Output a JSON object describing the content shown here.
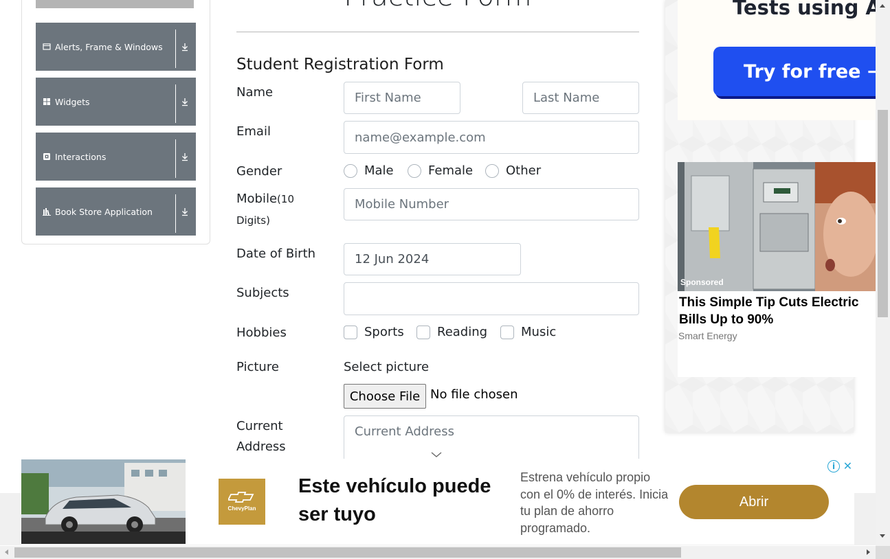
{
  "sidebar": {
    "groups": [
      {
        "label": "Alerts, Frame & Windows",
        "icon": "window-icon"
      },
      {
        "label": "Widgets",
        "icon": "grid-icon"
      },
      {
        "label": "Interactions",
        "icon": "interactions-icon"
      },
      {
        "label": "Book Store Application",
        "icon": "books-icon"
      }
    ]
  },
  "page": {
    "title": "Practice Form"
  },
  "form": {
    "heading": "Student Registration Form",
    "name_label": "Name",
    "first_name_placeholder": "First Name",
    "last_name_placeholder": "Last Name",
    "email_label": "Email",
    "email_placeholder": "name@example.com",
    "gender_label": "Gender",
    "gender_options": [
      "Male",
      "Female",
      "Other"
    ],
    "mobile_label": "Mobile",
    "mobile_hint_a": "(10",
    "mobile_hint_b": "Digits)",
    "mobile_placeholder": "Mobile Number",
    "dob_label": "Date of Birth",
    "dob_value": "12 Jun 2024",
    "subjects_label": "Subjects",
    "subjects_value": "",
    "hobbies_label": "Hobbies",
    "hobbies_options": [
      "Sports",
      "Reading",
      "Music"
    ],
    "picture_label": "Picture",
    "select_picture_label": "Select picture",
    "choose_file_label": "Choose File",
    "file_status": "No file chosen",
    "address_label_a": "Current",
    "address_label_b": "Address",
    "address_placeholder": "Current Address"
  },
  "right_ad": {
    "top_text": "Tests using A",
    "button_label": "Try for free →",
    "sponsored": "Sponsored",
    "headline": "This Simple Tip Cuts Electric Bills Up to 90%",
    "source": "Smart Energy"
  },
  "bottom_ad": {
    "logo_text": "ChevyPlan",
    "headline": "Este vehículo puede ser tuyo",
    "body": "Estrena vehículo propio con el 0% de interés. Inicia tu plan de ahorro programado.",
    "button_label": "Abrir",
    "info_glyph": "i",
    "close_glyph": "✕"
  },
  "colors": {
    "sidebar_group_bg": "#6c757d",
    "try_button": "#1f4ff0",
    "abrir_button": "#b3862e",
    "chevy_gold": "#c49a3c"
  }
}
